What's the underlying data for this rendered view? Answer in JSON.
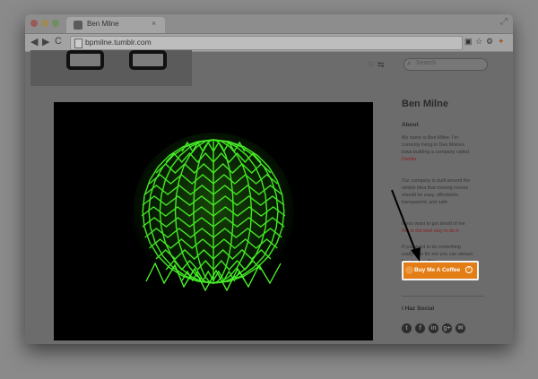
{
  "browser": {
    "tab_title": "Ben Milne",
    "tab_close": "×",
    "url": "bpmilne.tumblr.com",
    "nav_back": "◀",
    "nav_forward": "▶",
    "nav_reload": "C",
    "fullscreen": "⤢"
  },
  "page": {
    "search_placeholder": "Search",
    "search_icon": "⌕",
    "header_icons": [
      "♡",
      "⇆"
    ]
  },
  "sidebar": {
    "blog_title": "Ben Milne",
    "about_heading": "About",
    "about_p1_lines": [
      "My name is Ben Milne. I'm",
      "currently living in Des Moines",
      "Iowa building a company called"
    ],
    "about_p1_link": "Dwolla",
    "about_p2_lines": [
      "Our company is built around the",
      "simple idea that moving money",
      "should be easy, affordable,",
      "transparent, and safe."
    ],
    "about_p3_lines": [
      "If you want to get ahold of me"
    ],
    "about_p3_link": "this is the best way to do it.",
    "about_p4_lines": [
      "If you want to do something",
      "really nice for me you can always",
      "buy me a coffee."
    ],
    "coffee_button": "Buy Me A Coffee",
    "social_heading": "I Haz Social",
    "social_icons": [
      "t",
      "f",
      "in",
      "g+",
      "✉"
    ]
  },
  "colors": {
    "button": "#e37e17",
    "link": "#8a2020",
    "sphere_glow": "#4cff2a"
  }
}
